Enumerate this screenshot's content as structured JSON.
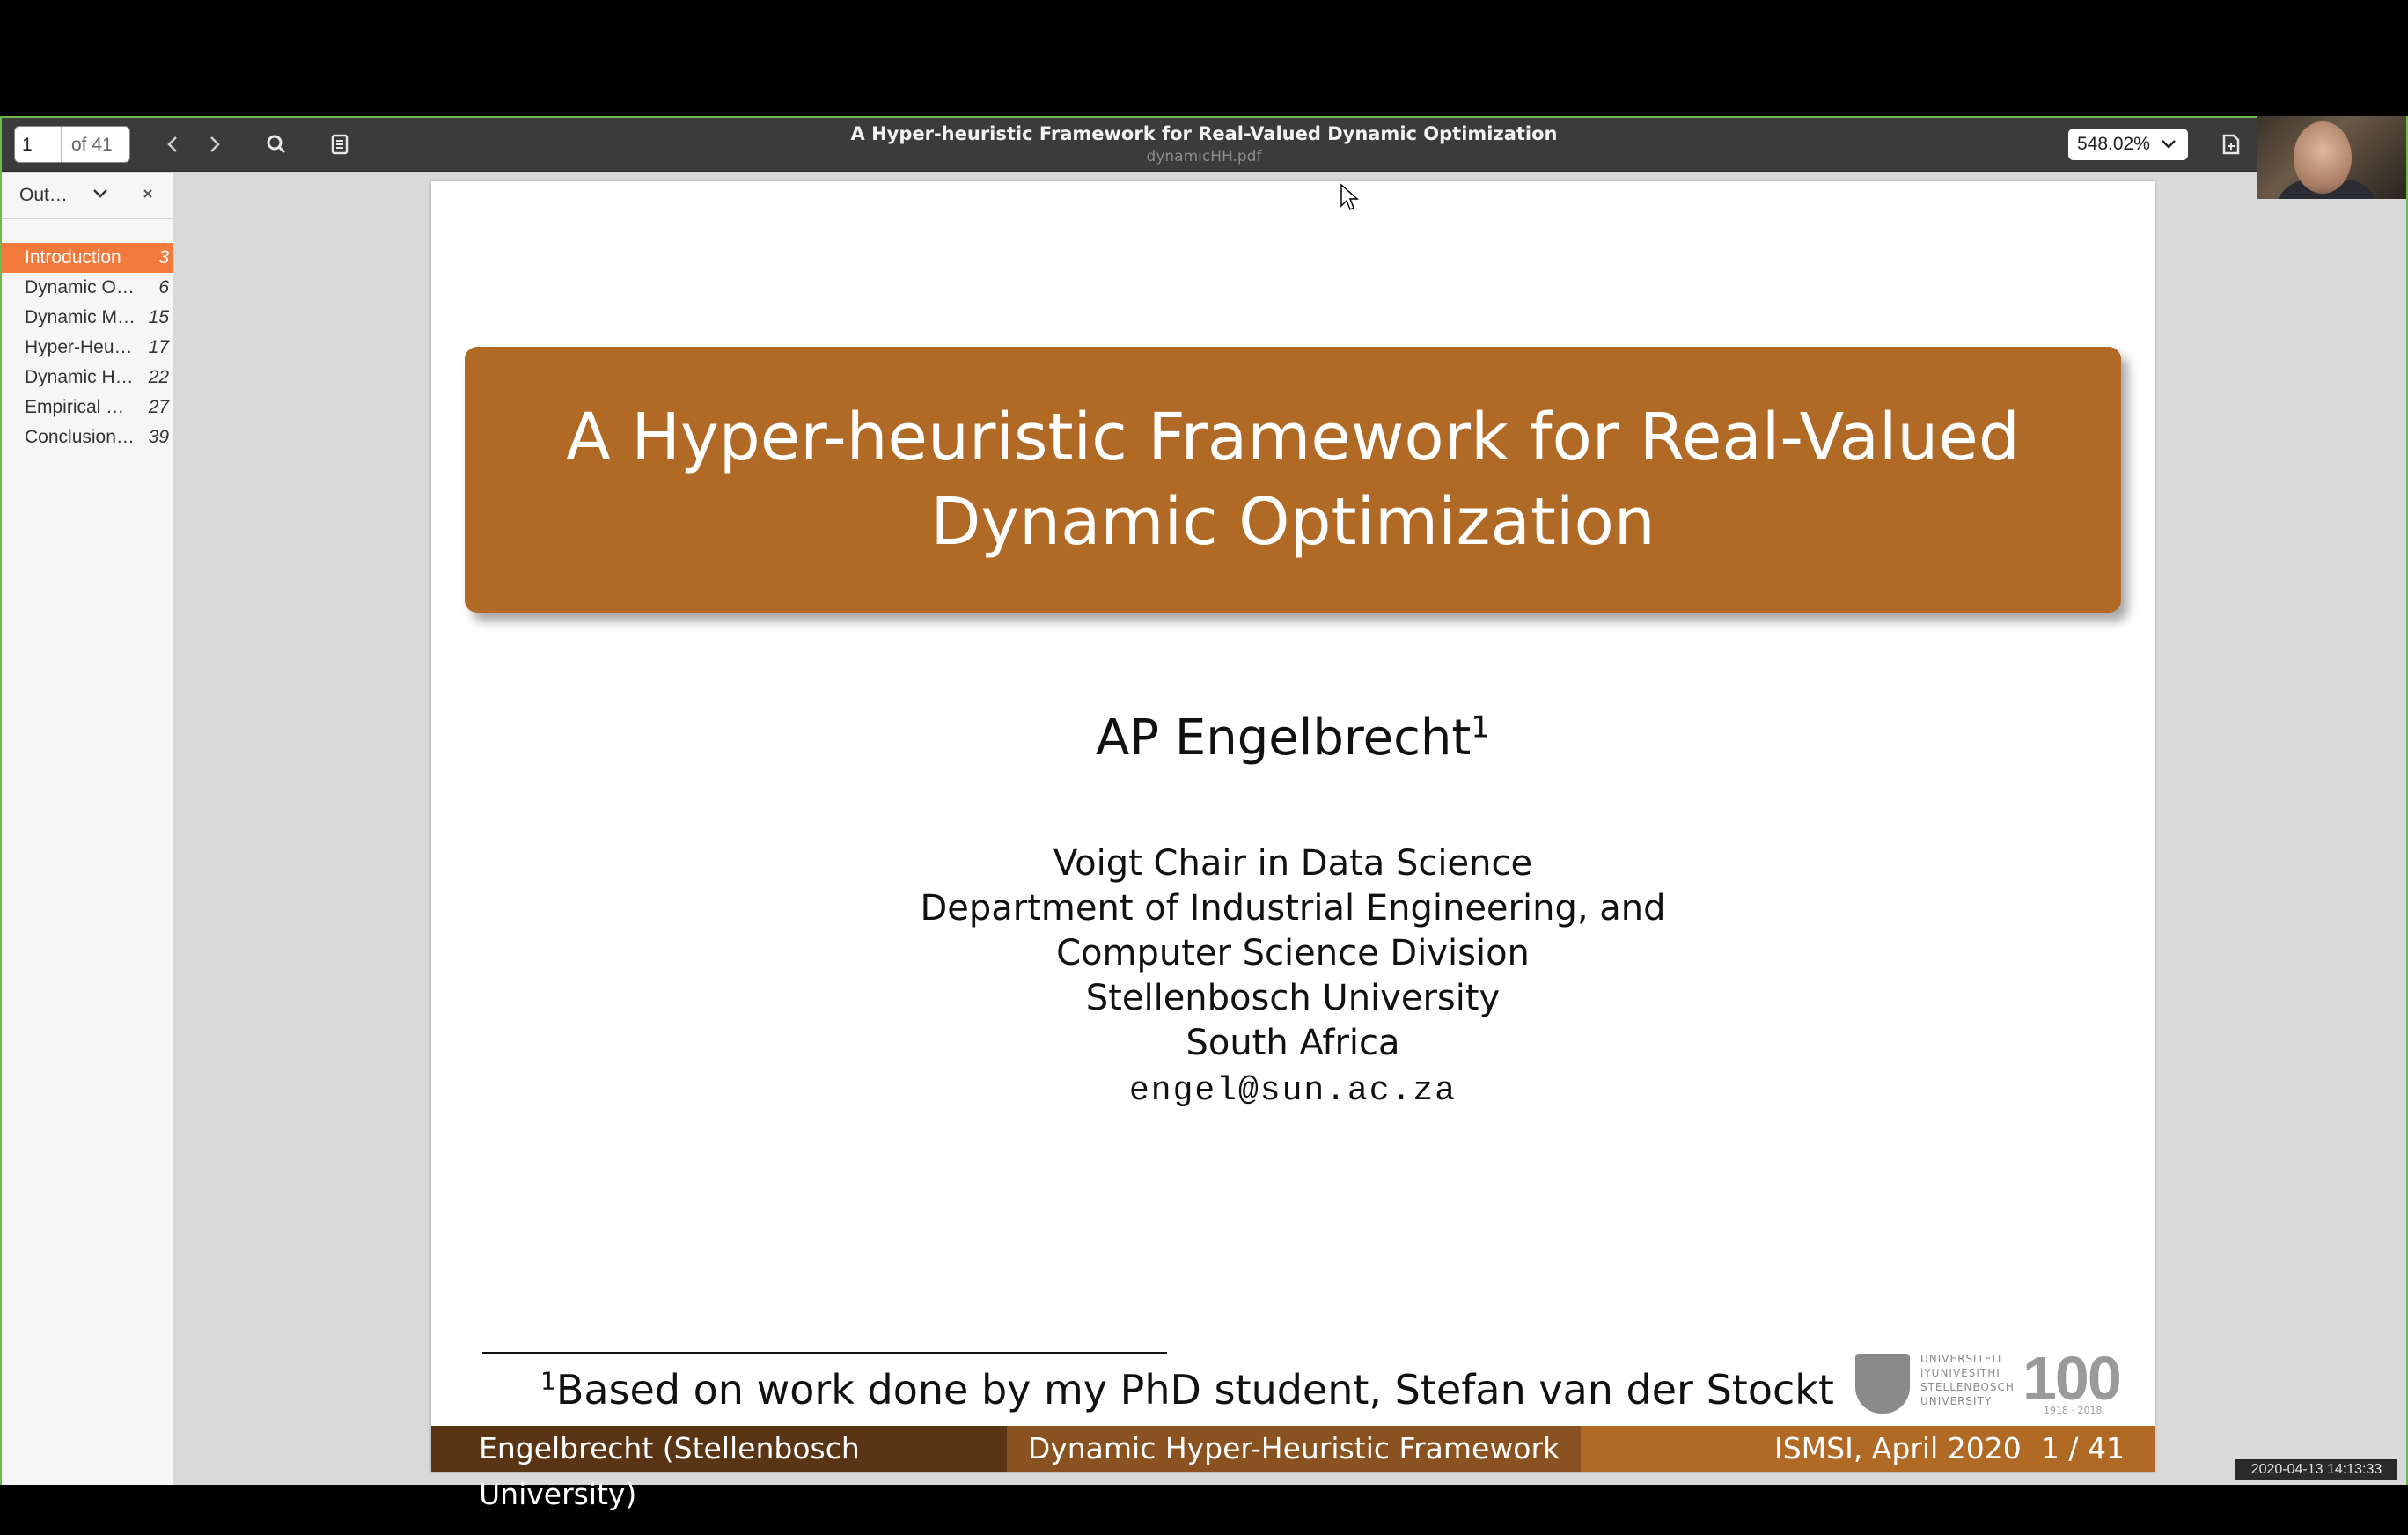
{
  "toolbar": {
    "page_current": "1",
    "page_total": "of 41",
    "doc_title": "A Hyper-heuristic Framework for Real-Valued Dynamic Optimization",
    "doc_filename": "dynamicHH.pdf",
    "zoom": "548.02%",
    "icons": [
      "chevron-left-icon",
      "chevron-right-icon",
      "search-icon",
      "annotations-icon",
      "save-icon"
    ]
  },
  "sidebar": {
    "selector": "Out…",
    "items": [
      {
        "label": "Introduction",
        "page": "3",
        "active": true
      },
      {
        "label": "Dynamic O…",
        "page": "6"
      },
      {
        "label": "Dynamic M…",
        "page": "15"
      },
      {
        "label": "Hyper-Heu…",
        "page": "17"
      },
      {
        "label": "Dynamic H…",
        "page": "22"
      },
      {
        "label": "Empirical …",
        "page": "27"
      },
      {
        "label": "Conclusion…",
        "page": "39"
      }
    ]
  },
  "slide": {
    "title_line1": "A Hyper-heuristic Framework for Real-Valued",
    "title_line2": "Dynamic Optimization",
    "author": "AP Engelbrecht",
    "author_sup": "1",
    "affiliation": [
      "Voigt Chair in Data Science",
      "Department of Industrial Engineering, and",
      "Computer Science Division",
      "Stellenbosch University",
      "South Africa"
    ],
    "email": "engel@sun.ac.za",
    "footnote_mark": "1",
    "footnote": "Based on work done by my PhD student, Stefan van der Stockt",
    "logo": {
      "uni_lines": [
        "UNIVERSITEIT",
        "iYUNIVESITHI",
        "STELLENBOSCH",
        "UNIVERSITY"
      ],
      "hundred": "100",
      "years": "1918 · 2018"
    },
    "footer": {
      "left": "Engelbrecht  (Stellenbosch University)",
      "middle": "Dynamic Hyper-Heuristic Framework",
      "conference": "ISMSI, April 2020",
      "page": "1 / 41"
    },
    "colors": {
      "accent": "#b06a26",
      "footer_dark": "#5a3515",
      "footer_mid": "#8a5220",
      "sidebar_active": "#f37a3d"
    }
  },
  "overlay": {
    "timestamp": "2020-04-13  14:13:33"
  }
}
